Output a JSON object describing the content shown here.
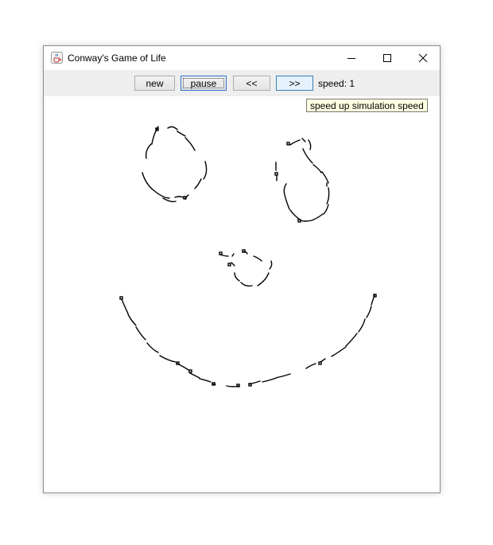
{
  "window": {
    "title": "Conway's Game of Life",
    "icon": "java-cup-icon",
    "controls": [
      "minimize-icon",
      "maximize-icon",
      "close-icon"
    ]
  },
  "toolbar": {
    "new_label": "new",
    "pause_label": "pause",
    "slower_label": "<<",
    "faster_label": ">>",
    "speed_text": "speed: 1"
  },
  "tooltip": {
    "text": "speed up simulation speed"
  },
  "colors": {
    "cell_color": "#000000",
    "toolbar_bg": "#eeeeee",
    "tooltip_bg": "#ffffe1"
  }
}
